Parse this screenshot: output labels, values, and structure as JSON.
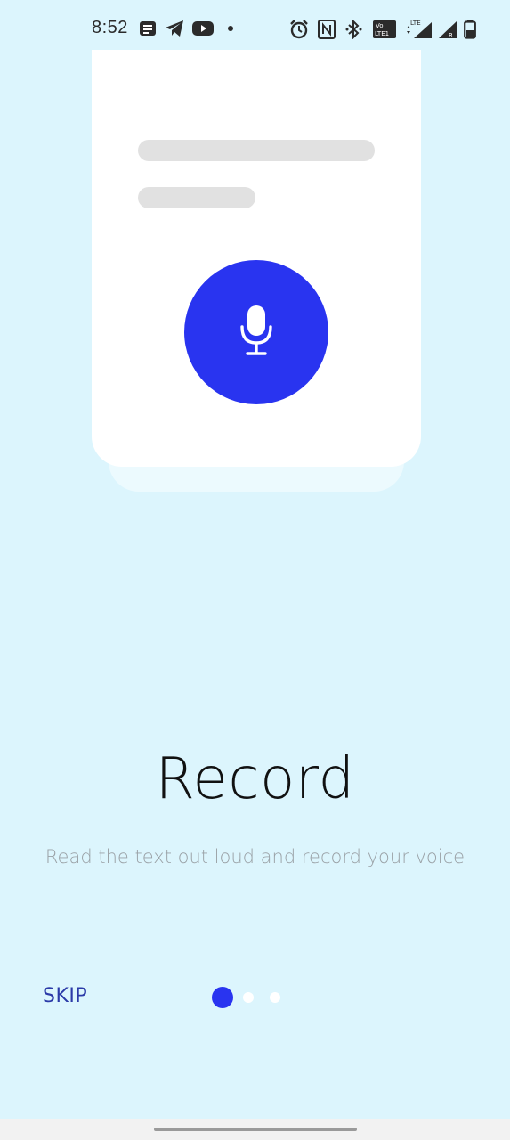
{
  "status_bar": {
    "time": "8:52",
    "icons": [
      "message-icon",
      "telegram-icon",
      "youtube-icon",
      "dot-icon",
      "alarm-icon",
      "nfc-icon",
      "bluetooth-icon",
      "volte-icon",
      "lte-signal-icon",
      "signal-icon",
      "battery-icon"
    ]
  },
  "illustration": {
    "mic_icon": "microphone-icon"
  },
  "onboarding": {
    "title": "Record",
    "subtitle": "Read the text out loud and record your voice",
    "skip_label": "SKIP",
    "page_index": 1,
    "page_count": 3
  },
  "colors": {
    "background": "#dcf5fd",
    "accent": "#2934f0",
    "skip_text": "#2b3aa8"
  }
}
